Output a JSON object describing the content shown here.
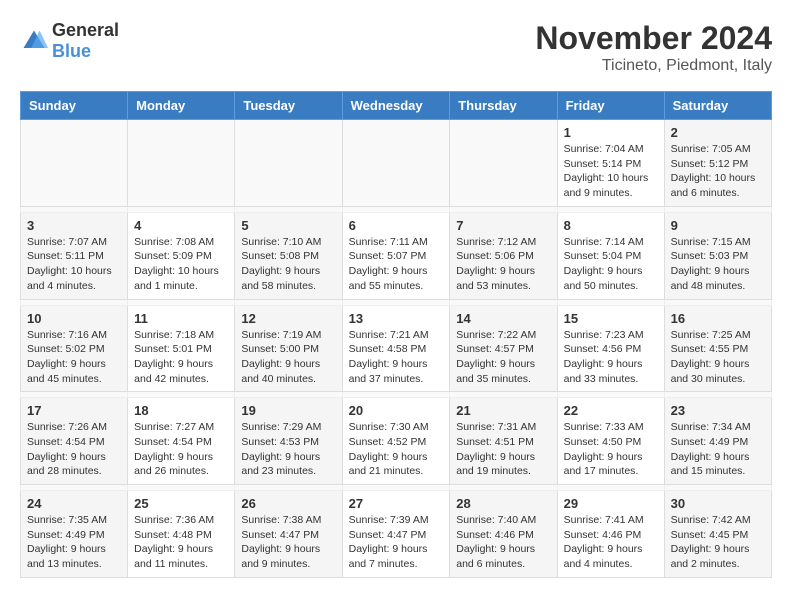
{
  "logo": {
    "text_general": "General",
    "text_blue": "Blue"
  },
  "header": {
    "month": "November 2024",
    "location": "Ticineto, Piedmont, Italy"
  },
  "weekdays": [
    "Sunday",
    "Monday",
    "Tuesday",
    "Wednesday",
    "Thursday",
    "Friday",
    "Saturday"
  ],
  "weeks": [
    [
      {
        "day": "",
        "info": ""
      },
      {
        "day": "",
        "info": ""
      },
      {
        "day": "",
        "info": ""
      },
      {
        "day": "",
        "info": ""
      },
      {
        "day": "",
        "info": ""
      },
      {
        "day": "1",
        "info": "Sunrise: 7:04 AM\nSunset: 5:14 PM\nDaylight: 10 hours and 9 minutes."
      },
      {
        "day": "2",
        "info": "Sunrise: 7:05 AM\nSunset: 5:12 PM\nDaylight: 10 hours and 6 minutes."
      }
    ],
    [
      {
        "day": "3",
        "info": "Sunrise: 7:07 AM\nSunset: 5:11 PM\nDaylight: 10 hours and 4 minutes."
      },
      {
        "day": "4",
        "info": "Sunrise: 7:08 AM\nSunset: 5:09 PM\nDaylight: 10 hours and 1 minute."
      },
      {
        "day": "5",
        "info": "Sunrise: 7:10 AM\nSunset: 5:08 PM\nDaylight: 9 hours and 58 minutes."
      },
      {
        "day": "6",
        "info": "Sunrise: 7:11 AM\nSunset: 5:07 PM\nDaylight: 9 hours and 55 minutes."
      },
      {
        "day": "7",
        "info": "Sunrise: 7:12 AM\nSunset: 5:06 PM\nDaylight: 9 hours and 53 minutes."
      },
      {
        "day": "8",
        "info": "Sunrise: 7:14 AM\nSunset: 5:04 PM\nDaylight: 9 hours and 50 minutes."
      },
      {
        "day": "9",
        "info": "Sunrise: 7:15 AM\nSunset: 5:03 PM\nDaylight: 9 hours and 48 minutes."
      }
    ],
    [
      {
        "day": "10",
        "info": "Sunrise: 7:16 AM\nSunset: 5:02 PM\nDaylight: 9 hours and 45 minutes."
      },
      {
        "day": "11",
        "info": "Sunrise: 7:18 AM\nSunset: 5:01 PM\nDaylight: 9 hours and 42 minutes."
      },
      {
        "day": "12",
        "info": "Sunrise: 7:19 AM\nSunset: 5:00 PM\nDaylight: 9 hours and 40 minutes."
      },
      {
        "day": "13",
        "info": "Sunrise: 7:21 AM\nSunset: 4:58 PM\nDaylight: 9 hours and 37 minutes."
      },
      {
        "day": "14",
        "info": "Sunrise: 7:22 AM\nSunset: 4:57 PM\nDaylight: 9 hours and 35 minutes."
      },
      {
        "day": "15",
        "info": "Sunrise: 7:23 AM\nSunset: 4:56 PM\nDaylight: 9 hours and 33 minutes."
      },
      {
        "day": "16",
        "info": "Sunrise: 7:25 AM\nSunset: 4:55 PM\nDaylight: 9 hours and 30 minutes."
      }
    ],
    [
      {
        "day": "17",
        "info": "Sunrise: 7:26 AM\nSunset: 4:54 PM\nDaylight: 9 hours and 28 minutes."
      },
      {
        "day": "18",
        "info": "Sunrise: 7:27 AM\nSunset: 4:54 PM\nDaylight: 9 hours and 26 minutes."
      },
      {
        "day": "19",
        "info": "Sunrise: 7:29 AM\nSunset: 4:53 PM\nDaylight: 9 hours and 23 minutes."
      },
      {
        "day": "20",
        "info": "Sunrise: 7:30 AM\nSunset: 4:52 PM\nDaylight: 9 hours and 21 minutes."
      },
      {
        "day": "21",
        "info": "Sunrise: 7:31 AM\nSunset: 4:51 PM\nDaylight: 9 hours and 19 minutes."
      },
      {
        "day": "22",
        "info": "Sunrise: 7:33 AM\nSunset: 4:50 PM\nDaylight: 9 hours and 17 minutes."
      },
      {
        "day": "23",
        "info": "Sunrise: 7:34 AM\nSunset: 4:49 PM\nDaylight: 9 hours and 15 minutes."
      }
    ],
    [
      {
        "day": "24",
        "info": "Sunrise: 7:35 AM\nSunset: 4:49 PM\nDaylight: 9 hours and 13 minutes."
      },
      {
        "day": "25",
        "info": "Sunrise: 7:36 AM\nSunset: 4:48 PM\nDaylight: 9 hours and 11 minutes."
      },
      {
        "day": "26",
        "info": "Sunrise: 7:38 AM\nSunset: 4:47 PM\nDaylight: 9 hours and 9 minutes."
      },
      {
        "day": "27",
        "info": "Sunrise: 7:39 AM\nSunset: 4:47 PM\nDaylight: 9 hours and 7 minutes."
      },
      {
        "day": "28",
        "info": "Sunrise: 7:40 AM\nSunset: 4:46 PM\nDaylight: 9 hours and 6 minutes."
      },
      {
        "day": "29",
        "info": "Sunrise: 7:41 AM\nSunset: 4:46 PM\nDaylight: 9 hours and 4 minutes."
      },
      {
        "day": "30",
        "info": "Sunrise: 7:42 AM\nSunset: 4:45 PM\nDaylight: 9 hours and 2 minutes."
      }
    ]
  ]
}
